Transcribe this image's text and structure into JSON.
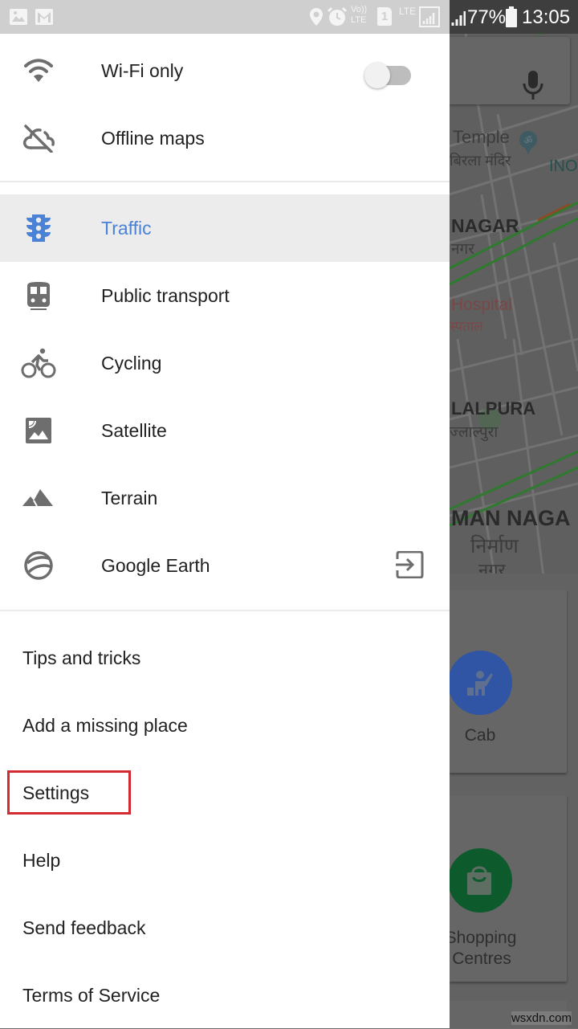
{
  "status_bar": {
    "left_icons": [
      "gallery-icon",
      "gmail-icon"
    ],
    "right_icons": [
      "location-icon",
      "alarm-icon",
      "volte-icon",
      "sim-1-icon",
      "lte-signal-icon",
      "signal-icon"
    ],
    "volte_label": "Vo)) LTE",
    "sim_label": "1",
    "lte_label": "LTE",
    "battery": "77%",
    "time": "13:05"
  },
  "drawer": {
    "top_items": [
      {
        "icon": "wifi-icon",
        "label": "Wi-Fi only",
        "toggle": false
      },
      {
        "icon": "cloud-off-icon",
        "label": "Offline maps"
      }
    ],
    "layer_items": [
      {
        "icon": "traffic-light-icon",
        "label": "Traffic",
        "selected": true
      },
      {
        "icon": "train-icon",
        "label": "Public transport"
      },
      {
        "icon": "bicycle-icon",
        "label": "Cycling"
      },
      {
        "icon": "satellite-icon",
        "label": "Satellite"
      },
      {
        "icon": "terrain-icon",
        "label": "Terrain"
      },
      {
        "icon": "google-earth-icon",
        "label": "Google Earth",
        "trailing_icon": "open-external-icon"
      }
    ],
    "bottom_items": [
      {
        "label": "Tips and tricks"
      },
      {
        "label": "Add a missing place"
      },
      {
        "label": "Settings",
        "highlighted": true
      },
      {
        "label": "Help"
      },
      {
        "label": "Send feedback"
      },
      {
        "label": "Terms of Service"
      }
    ],
    "accent_color": "#4a83d6",
    "highlight_color": "#d42a34"
  },
  "map": {
    "labels": {
      "temple": "Temple",
      "temple_hi": "बिरला मंदिर",
      "ino": "INO",
      "nagar": "NAGAR",
      "nagar_hi": "नगर",
      "hospital": "Hospital",
      "hospital_hi": "स्पताल",
      "lalpura": "LALPURA",
      "lalpura_hi": "ज्लाल्पुरा",
      "man_nagar": "MAN NAGA",
      "nirman_hi": "निर्माण",
      "nagar2_hi": "नगर"
    },
    "categories": [
      {
        "label": "Cab",
        "icon": "cab-icon",
        "color": "#2f55a4"
      },
      {
        "label": "Shopping Centres",
        "label_line1": "Shopping",
        "label_line2": "Centres",
        "icon": "shopping-bag-icon",
        "color": "#0d5a2d"
      }
    ],
    "watermark": "wsxdn.com"
  }
}
